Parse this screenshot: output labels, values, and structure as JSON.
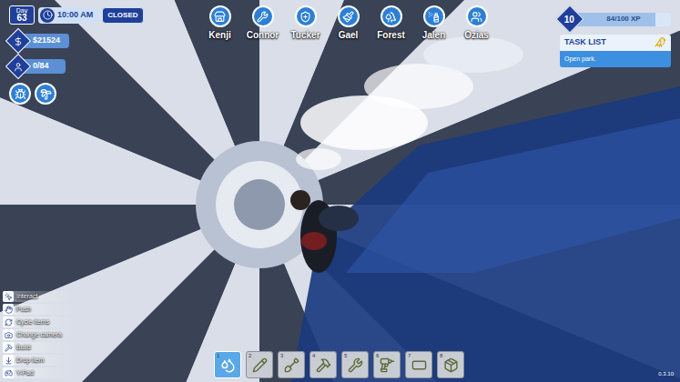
{
  "hud": {
    "day_label": "Day",
    "day": "63",
    "time": "10:00 AM",
    "park_status": "CLOSED",
    "money": "$21524",
    "guests": "0/84"
  },
  "staff": [
    {
      "name": "Kenji"
    },
    {
      "name": "Connor"
    },
    {
      "name": "Tucker"
    },
    {
      "name": "Gael"
    },
    {
      "name": "Forest"
    },
    {
      "name": "Jalen"
    },
    {
      "name": "Ozias"
    }
  ],
  "level": {
    "value": "10",
    "xp": "84/100 XP",
    "level": 0.84
  },
  "task_list": {
    "title": "TASK LIST",
    "tasks": [
      "Open park."
    ]
  },
  "controls": [
    {
      "label": "Interact"
    },
    {
      "label": "Push"
    },
    {
      "label": "Cycle items"
    },
    {
      "label": "Change camera"
    },
    {
      "label": "Build"
    },
    {
      "label": "Drop item"
    },
    {
      "label": "Y-Pad"
    }
  ],
  "hotbar": [
    {
      "slot": "1",
      "selected": true
    },
    {
      "slot": "2",
      "selected": false
    },
    {
      "slot": "3",
      "selected": false
    },
    {
      "slot": "4",
      "selected": false
    },
    {
      "slot": "5",
      "selected": false
    },
    {
      "slot": "6",
      "selected": false
    },
    {
      "slot": "7",
      "selected": false
    },
    {
      "slot": "8",
      "selected": false
    }
  ],
  "version": "0.3.10"
}
